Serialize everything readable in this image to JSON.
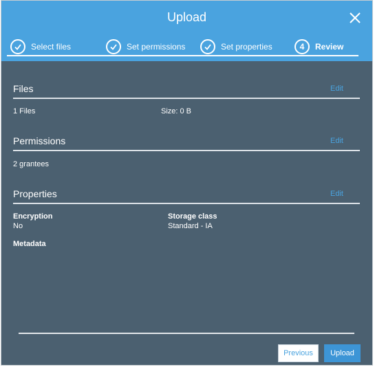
{
  "modal": {
    "title": "Upload"
  },
  "steps": [
    {
      "label": "Select files",
      "state": "complete"
    },
    {
      "label": "Set permissions",
      "state": "complete"
    },
    {
      "label": "Set properties",
      "state": "complete"
    },
    {
      "label": "Review",
      "number": "4",
      "state": "active"
    }
  ],
  "sections": {
    "files": {
      "title": "Files",
      "edit_label": "Edit",
      "count": "1 Files",
      "size": "Size: 0 B"
    },
    "permissions": {
      "title": "Permissions",
      "edit_label": "Edit",
      "grantees": "2 grantees"
    },
    "properties": {
      "title": "Properties",
      "edit_label": "Edit",
      "encryption_label": "Encryption",
      "encryption_value": "No",
      "storage_class_label": "Storage class",
      "storage_class_value": "Standard - IA",
      "metadata_label": "Metadata"
    }
  },
  "footer": {
    "previous_label": "Previous",
    "upload_label": "Upload"
  },
  "colors": {
    "header_bg": "#4aa3df",
    "body_bg": "#4b6070",
    "link": "#4aa3df",
    "primary_button": "#3d95d6"
  }
}
